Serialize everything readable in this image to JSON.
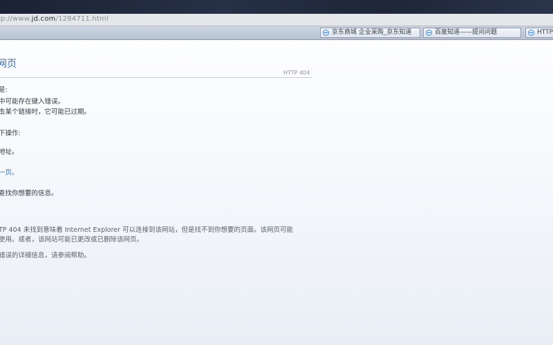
{
  "address_bar": {
    "url_prefix": "http://www.",
    "url_domain": "jd.com",
    "url_path": "/1284711.html"
  },
  "favorites": [
    {
      "label": "京东商城 企业采购_京东知道"
    },
    {
      "label": "百度知道——提问问题"
    },
    {
      "label": "HTTP"
    }
  ],
  "error_page": {
    "title": "网页",
    "http_code": "HTTP 404",
    "cause_heading": "是:",
    "cause_1": "中可能存在键入错误。",
    "cause_2": "击某个链接时，它可能已过期。",
    "try_heading": "下操作:",
    "try_1": "地址。",
    "try_2_link": "一页。",
    "try_3": "查找你想要的信息。",
    "details_1": "TP 404 未找到意味着 Internet Explorer 可以连接到该网站，但是找不到你想要的页面。该网页可能",
    "details_2": "使用。或者，该网站可能已更改或已删除该网页。",
    "details_3": "错误的详细信息，请参阅帮助。"
  }
}
